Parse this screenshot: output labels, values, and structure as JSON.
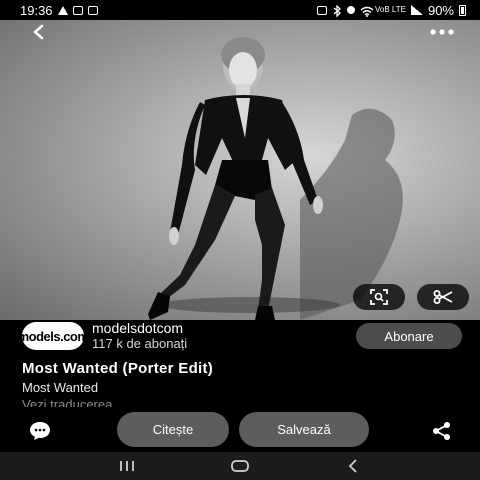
{
  "status_bar": {
    "time": "19:36",
    "left_icons": [
      "warning-icon",
      "message-icon",
      "image-icon"
    ],
    "right_icons": [
      "nfc-icon",
      "bluetooth-icon",
      "vibrate-icon",
      "wifi-icon",
      "volte-icon",
      "signal-icon",
      "battery-icon"
    ],
    "volte_label": "VoB LTE",
    "battery": "90%"
  },
  "top_bar": {
    "back_icon": "chevron-left-icon",
    "more_icon": "more-horizontal-icon"
  },
  "image_actions": {
    "lens_icon": "visual-search-icon",
    "cut_icon": "scissors-icon"
  },
  "profile": {
    "avatar_text": "models.com",
    "name": "modelsdotcom",
    "subscribers": "117 k de abonați",
    "follow_label": "Abonare"
  },
  "pin": {
    "title": "Most Wanted (Porter Edit)",
    "description": "Most Wanted",
    "see_translation": "Vezi traducerea"
  },
  "actions": {
    "comment_icon": "comment-icon",
    "read_label": "Citește",
    "save_label": "Salvează",
    "share_icon": "share-icon"
  },
  "nav": {
    "recents_icon": "recents-icon",
    "home_icon": "home-icon",
    "back_icon": "back-icon"
  }
}
